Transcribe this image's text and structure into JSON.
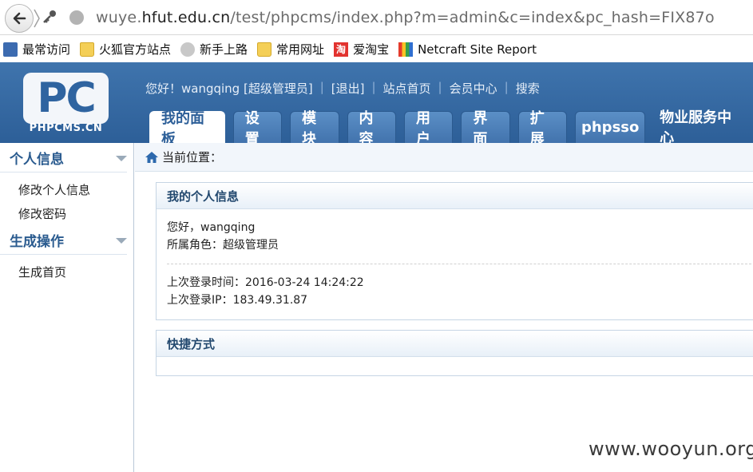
{
  "browser": {
    "url_prefix": "wuye.",
    "url_domain": "hfut.edu.cn",
    "url_path": "/test/phpcms/index.php?m=admin&c=index&pc_hash=FIX87o"
  },
  "bookmarks": [
    {
      "label": "最常访问",
      "icon": "most-visited-icon"
    },
    {
      "label": "火狐官方站点",
      "icon": "folder-icon"
    },
    {
      "label": "新手上路",
      "icon": "globe-icon"
    },
    {
      "label": "常用网址",
      "icon": "folder-icon"
    },
    {
      "label": "爱淘宝",
      "icon": "taobao-icon"
    },
    {
      "label": "Netcraft Site Report",
      "icon": "netcraft-icon"
    }
  ],
  "taobao_glyph": "淘",
  "logo": {
    "mark": "PC",
    "text": "PHPCMS.CN"
  },
  "top_links": {
    "greeting": "您好！wangqing [超级管理员]",
    "logout": "[退出]",
    "site_home": "站点首页",
    "member_center": "会员中心",
    "search": "搜索"
  },
  "nav_tabs": [
    {
      "label": "我的面板",
      "active": true
    },
    {
      "label": "设置"
    },
    {
      "label": "模块"
    },
    {
      "label": "内容"
    },
    {
      "label": "用户"
    },
    {
      "label": "界面"
    },
    {
      "label": "扩展"
    },
    {
      "label": "phpsso"
    },
    {
      "label": "物业服务中心"
    }
  ],
  "sidebar": {
    "groups": [
      {
        "title": "个人信息",
        "items": [
          "修改个人信息",
          "修改密码"
        ]
      },
      {
        "title": "生成操作",
        "items": [
          "生成首页"
        ]
      }
    ]
  },
  "breadcrumb": {
    "label": "当前位置："
  },
  "info_panel": {
    "title": "我的个人信息",
    "hello": "您好，wangqing",
    "role": "所属角色：超级管理员",
    "last_login_time": "上次登录时间：2016-03-24 14:24:22",
    "last_login_ip": "上次登录IP：183.49.31.87"
  },
  "shortcut_panel": {
    "title": "快捷方式"
  },
  "watermark": "www.wooyun.org",
  "colors": {
    "header": "#3a6ba4",
    "accent": "#2d5f98"
  }
}
